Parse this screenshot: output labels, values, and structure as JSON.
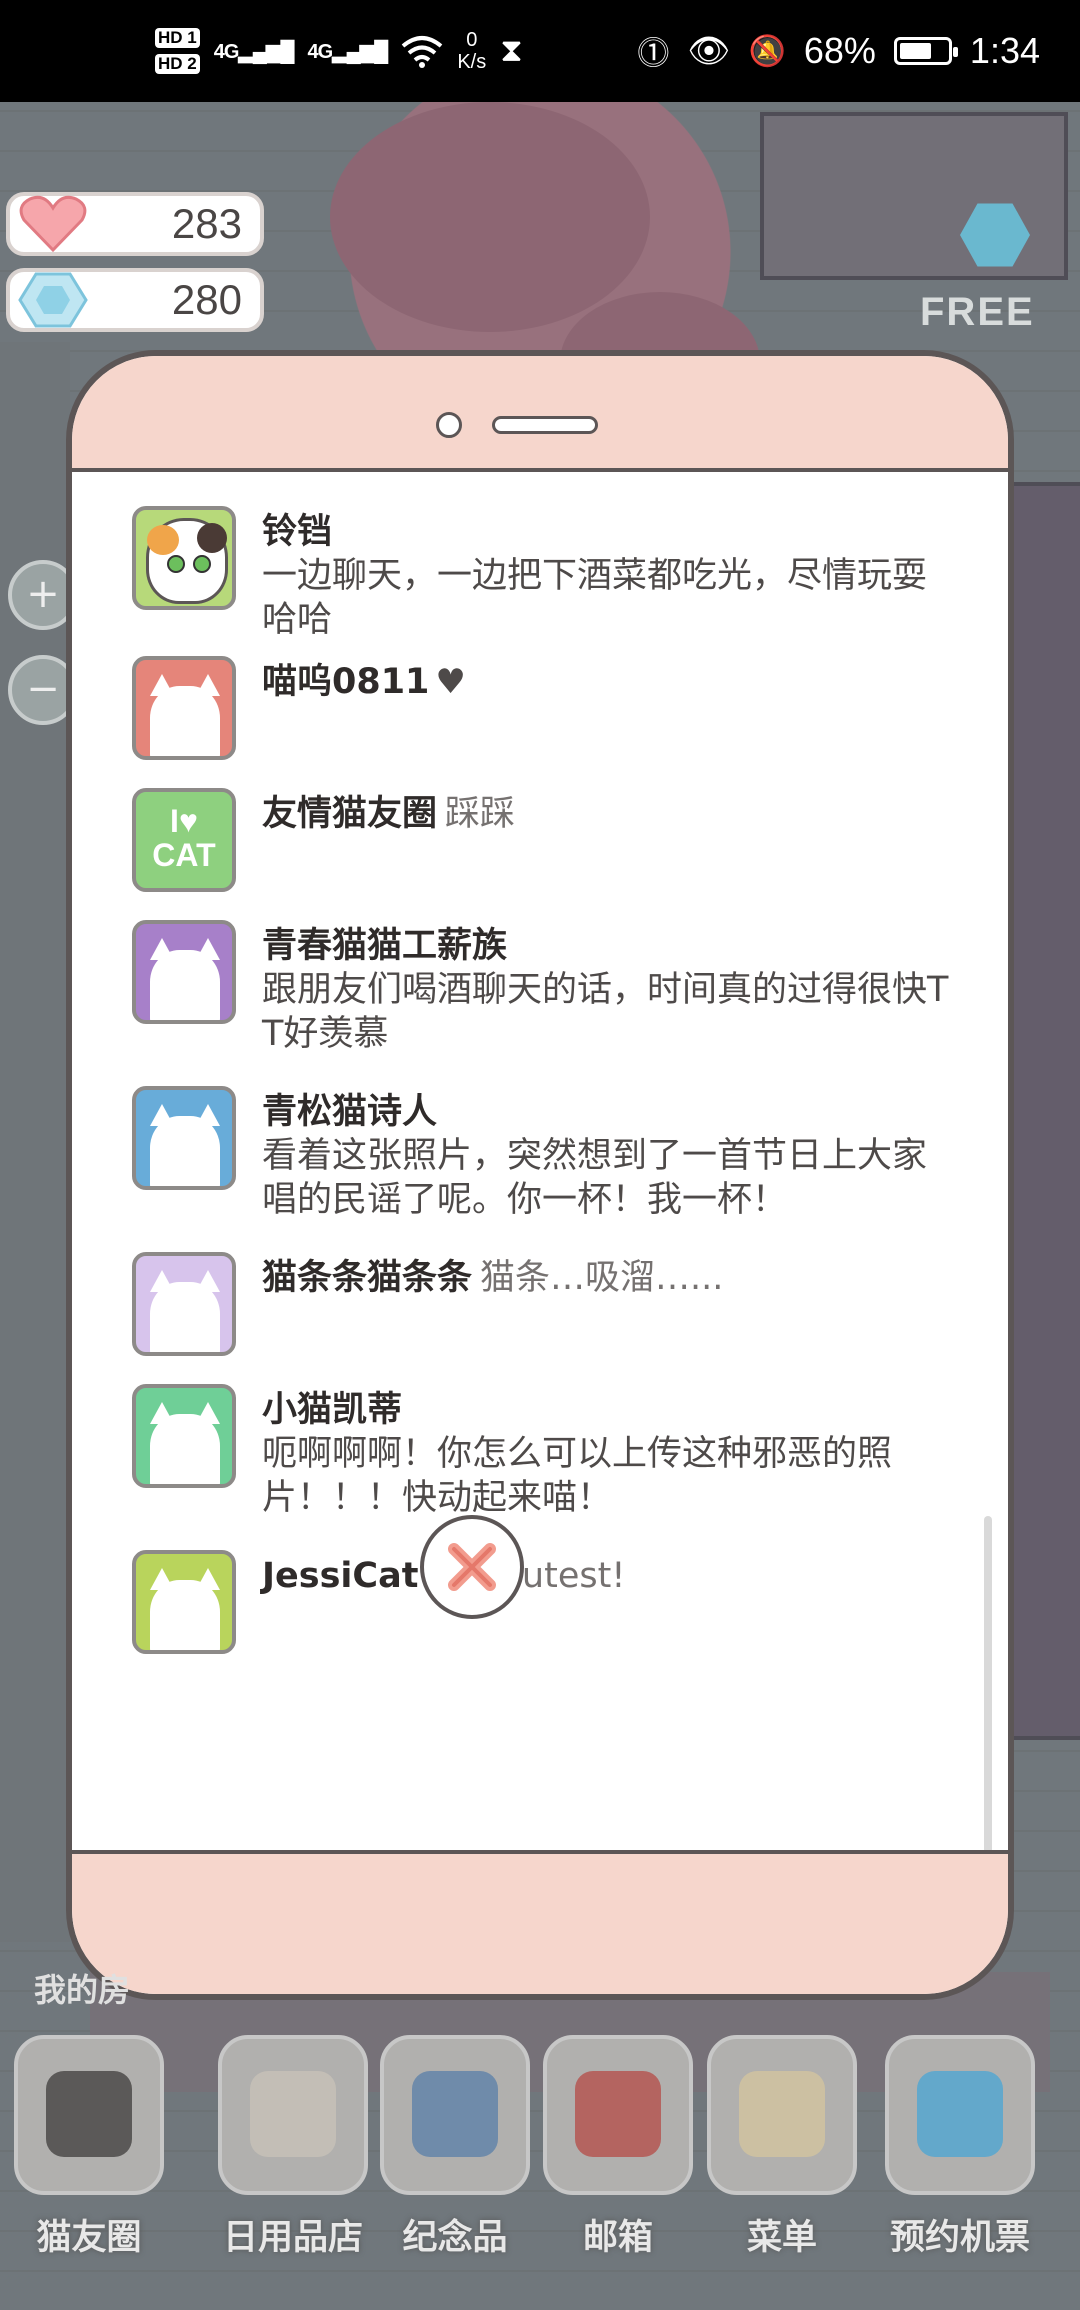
{
  "status_bar": {
    "hd1": "HD 1",
    "hd2": "HD 2",
    "net1": "4G",
    "net2": "4G",
    "speed_value": "0",
    "speed_unit": "K/s",
    "battery_percent": "68%",
    "battery_level": 0.68,
    "time": "1:34"
  },
  "resources": {
    "hearts": "283",
    "gems": "280",
    "free_label": "FREE"
  },
  "modal": {
    "posts": [
      {
        "name": "铃铛",
        "message": "一边聊天，一边把下酒菜都吃光，尽情玩耍哈哈",
        "avatar_color": "#b7d97a",
        "avatar": "calico"
      },
      {
        "name": "喵呜0811",
        "message": "♥",
        "avatar_color": "#e5857a",
        "avatar": "silhouette"
      },
      {
        "name": "友情猫友圈",
        "message": "踩踩",
        "avatar_color": "#8ed07f",
        "avatar": "i-love-cat",
        "avatar_text": "I♥ CAT"
      },
      {
        "name": "青春猫猫工薪族",
        "message": "跟朋友们喝酒聊天的话，时间真的过得很快T T好羡慕",
        "avatar_color": "#a780c9",
        "avatar": "silhouette"
      },
      {
        "name": "青松猫诗人",
        "message": "看着这张照片，突然想到了一首节日上大家唱的民谣了呢。你一杯！我一杯！",
        "avatar_color": "#68acd9",
        "avatar": "silhouette"
      },
      {
        "name": "猫条条猫条条",
        "message": "猫条…吸溜…...",
        "avatar_color": "#d7c4ec",
        "avatar": "silhouette"
      },
      {
        "name": "小猫凯蒂",
        "message": "呃啊啊啊！你怎么可以上传这种邪恶的照片！！！快动起来喵！",
        "avatar_color": "#6fcf97",
        "avatar": "silhouette"
      },
      {
        "name": "JessiCat",
        "message": "The cutest!",
        "avatar_color": "#b9d45c",
        "avatar": "silhouette"
      }
    ]
  },
  "dock": {
    "items": [
      {
        "label": "猫友圈",
        "icon": "cat-friends-icon"
      },
      {
        "label": "日用品店",
        "icon": "shop-icon"
      },
      {
        "label": "纪念品",
        "icon": "souvenir-box-icon"
      },
      {
        "label": "邮箱",
        "icon": "mailbox-icon"
      },
      {
        "label": "菜单",
        "icon": "menu-folder-icon"
      },
      {
        "label": "预约机票",
        "icon": "airplane-icon"
      }
    ],
    "my_room_partial": "我的房"
  }
}
